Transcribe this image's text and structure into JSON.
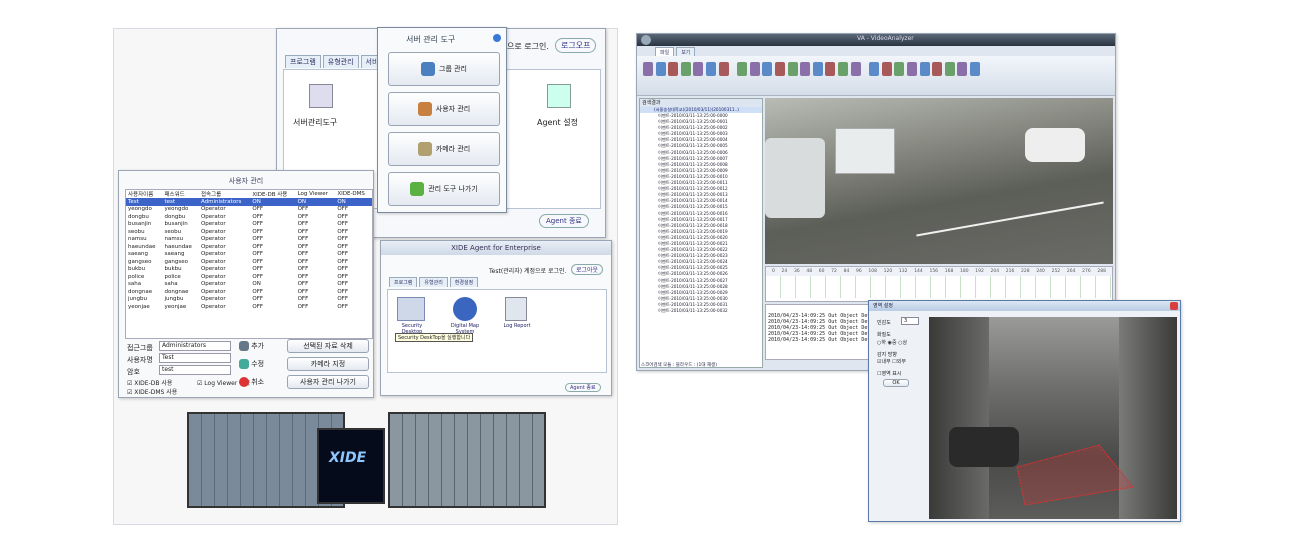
{
  "server_tool": {
    "tabs": [
      "프로그램",
      "유형관리",
      "서비"
    ],
    "login_text": "으로 로그인.",
    "logout_label": "로그오프",
    "server_admin_label": "서버관리도구",
    "agent_settings_label": "Agent 설정",
    "agent_exit_label": "Agent 종료"
  },
  "server_menu": {
    "title": "서버 관리 도구",
    "items": [
      "그룹 관리",
      "사용자 관리",
      "카메라 관리",
      "관리 도구 나가기"
    ]
  },
  "user_mgmt": {
    "title": "사용자 관리",
    "columns": [
      "사용자이름",
      "패스워드",
      "접속그룹",
      "XIDE-DB 사용",
      "Log Viewer",
      "XIDE-DMS"
    ],
    "rows": [
      [
        "Test",
        "test",
        "Administrators",
        "ON",
        "ON",
        "ON"
      ],
      [
        "yeongdo",
        "yeongdo",
        "Operator",
        "OFF",
        "OFF",
        "OFF"
      ],
      [
        "dongbu",
        "dongbu",
        "Operator",
        "OFF",
        "OFF",
        "OFF"
      ],
      [
        "busanjin",
        "busanjin",
        "Operator",
        "OFF",
        "OFF",
        "OFF"
      ],
      [
        "seobu",
        "seobu",
        "Operator",
        "OFF",
        "OFF",
        "OFF"
      ],
      [
        "namsu",
        "namsu",
        "Operator",
        "OFF",
        "OFF",
        "OFF"
      ],
      [
        "haeundae",
        "haeundae",
        "Operator",
        "OFF",
        "OFF",
        "OFF"
      ],
      [
        "saeang",
        "saeang",
        "Operator",
        "OFF",
        "OFF",
        "OFF"
      ],
      [
        "gangseo",
        "gangseo",
        "Operator",
        "OFF",
        "OFF",
        "OFF"
      ],
      [
        "bukbu",
        "bukbu",
        "Operator",
        "OFF",
        "OFF",
        "OFF"
      ],
      [
        "police",
        "police",
        "Operator",
        "OFF",
        "OFF",
        "OFF"
      ],
      [
        "saha",
        "saha",
        "Operator",
        "ON",
        "OFF",
        "OFF"
      ],
      [
        "dongnae",
        "dongnae",
        "Operator",
        "OFF",
        "OFF",
        "OFF"
      ],
      [
        "jungbu",
        "jungbu",
        "Operator",
        "OFF",
        "OFF",
        "OFF"
      ],
      [
        "yeonjae",
        "yeonjae",
        "Operator",
        "OFF",
        "OFF",
        "OFF"
      ]
    ],
    "group_label": "접근그룹",
    "group_value": "Administrators",
    "user_label": "사용자명",
    "user_value": "Test",
    "pw_label": "암호",
    "pw_value": "test",
    "chk_db": "XIDE-DB 사용",
    "chk_dms": "XIDE-DMS 사용",
    "chk_log": "Log Viewer 사용",
    "btn_add": "추가",
    "btn_edit": "수정",
    "btn_cancel": "취소",
    "btn_delete": "선택된 자료 삭제",
    "btn_camera": "카메라 지정",
    "btn_exit": "사용자 관리 나가기"
  },
  "agent": {
    "title": "XIDE Agent for Enterprise",
    "login_text": "Test(관리자) 계정으로 로그인.",
    "logout_label": "로그아웃",
    "tabs": [
      "프로그램",
      "유형관리",
      "환경설정"
    ],
    "apps": [
      "Security Desktop",
      "Digital Map System",
      "Log Report"
    ],
    "tooltip": "Security DeskTop을 실행합니다",
    "exit_label": "Agent 종료"
  },
  "splash": {
    "logo": "XIDE"
  },
  "analyzer": {
    "title": "VA - VideoAnalyzer",
    "tabs": [
      "파일",
      "보기"
    ],
    "panel_title": "검색결과",
    "tree_root": "(서울숭실대학교)(2010/03/11)(20100311..)",
    "tree_items": [
      "이벤트-2010/03/11-13:25:00-0000",
      "이벤트-2010/03/11-13:25:00-0001",
      "이벤트-2010/03/11-13:25:00-0002",
      "이벤트-2010/03/11-13:25:00-0003",
      "이벤트-2010/03/11-13:25:00-0004",
      "이벤트-2010/03/11-13:25:00-0005",
      "이벤트-2010/03/11-13:25:00-0006",
      "이벤트-2010/03/11-13:25:00-0007",
      "이벤트-2010/03/11-13:25:00-0008",
      "이벤트-2010/03/11-13:25:00-0009",
      "이벤트-2010/03/11-13:25:00-0010",
      "이벤트-2010/03/11-13:25:00-0011",
      "이벤트-2010/03/11-13:25:00-0012",
      "이벤트-2010/03/11-13:25:00-0013",
      "이벤트-2010/03/11-13:25:00-0014",
      "이벤트-2010/03/11-13:25:00-0015",
      "이벤트-2010/03/11-13:25:00-0016",
      "이벤트-2010/03/11-13:25:00-0017",
      "이벤트-2010/03/11-13:25:00-0018",
      "이벤트-2010/03/11-13:25:00-0019",
      "이벤트-2010/03/11-13:25:00-0020",
      "이벤트-2010/03/11-13:25:00-0021",
      "이벤트-2010/03/11-13:25:00-0022",
      "이벤트-2010/03/11-13:25:00-0023",
      "이벤트-2010/03/11-13:25:00-0024",
      "이벤트-2010/03/11-13:25:00-0025",
      "이벤트-2010/03/11-13:25:00-0026",
      "이벤트-2010/03/11-13:25:00-0027",
      "이벤트-2010/03/11-13:25:00-0028",
      "이벤트-2010/03/11-13:25:00-0029",
      "이벤트-2010/03/11-13:25:00-0030",
      "이벤트-2010/03/11-13:25:00-0031",
      "이벤트-2010/03/11-13:25:00-0032"
    ],
    "timeline_ticks": [
      "0",
      "24",
      "36",
      "48",
      "60",
      "72",
      "84",
      "96",
      "108",
      "120",
      "132",
      "144",
      "156",
      "168",
      "180",
      "192",
      "204",
      "216",
      "228",
      "240",
      "252",
      "264",
      "276",
      "288"
    ],
    "log_lines": [
      "2010/04/23-14:09:25 Out Object Detect",
      "2010/04/23-14:09:25 Out Object Detect",
      "2010/04/23-14:09:25 Out Object Detect",
      "2010/04/23-14:09:25 Out Object Detect",
      "2010/04/23-14:09:25 Out Object Detect"
    ],
    "status": "스코어검색 모듈 : 블라우드 : (1대 재생)"
  },
  "region": {
    "title": "영역 설정",
    "label_level": "민감도",
    "level_value": "3",
    "label_quality": "화질도",
    "opt1": "하",
    "opt2": "중",
    "opt3": "상",
    "label_dir": "감지 방향",
    "chk_in": "내부",
    "chk_out": "외부",
    "chk_show": "영역 표시",
    "ok": "OK"
  },
  "colors": {
    "accent": "#3c64c8",
    "region": "#e03030"
  }
}
